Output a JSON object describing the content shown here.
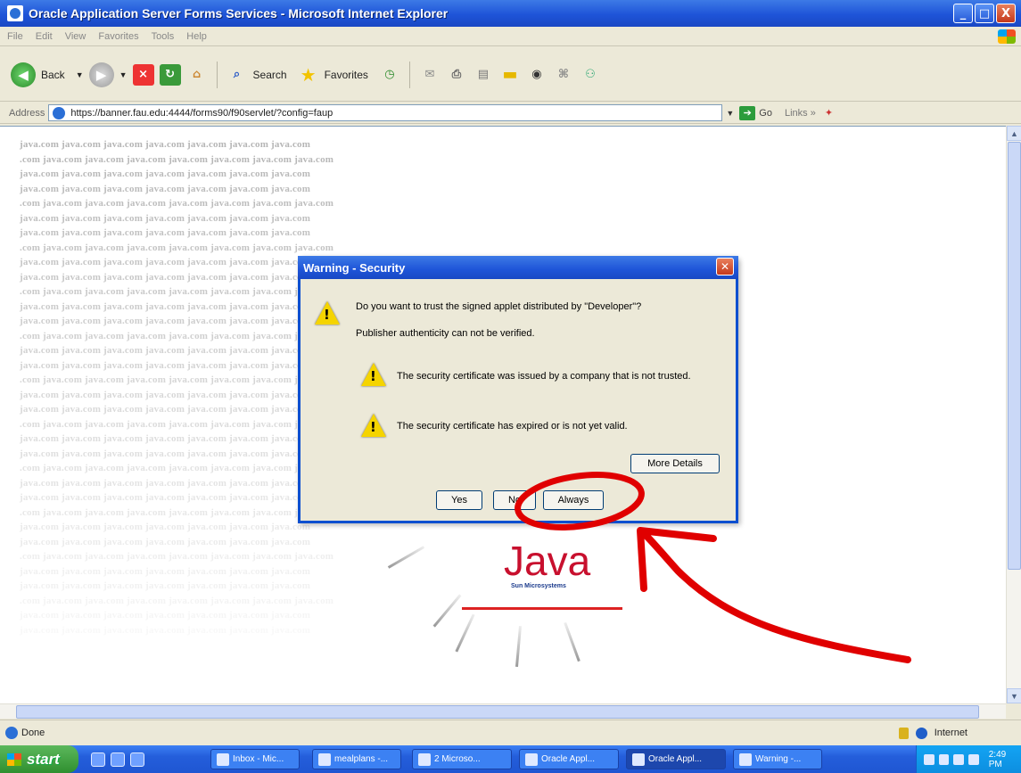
{
  "window": {
    "title": "Oracle Application Server Forms Services - Microsoft Internet Explorer",
    "buttons": {
      "minimize": "_",
      "maximize": "□",
      "close": "X"
    }
  },
  "menu": [
    "File",
    "Edit",
    "View",
    "Favorites",
    "Tools",
    "Help"
  ],
  "toolbar": {
    "back": "Back",
    "search": "Search",
    "favorites": "Favorites"
  },
  "address": {
    "label": "Address",
    "url": "https://banner.fau.edu:4444/forms90/f90servlet/?config=faup",
    "go": "Go",
    "links": "Links »"
  },
  "watermark": {
    "left": [
      "java.com  java.com  java.com  java.com  java.com  java.com  java.com",
      ".com  java.com  java.com  java.com  java.com  java.com  java.com  java.com",
      "java.com  java.com  java.com  java.com  java.com  java.com  java.com"
    ]
  },
  "dialog": {
    "title": "Warning - Security",
    "question": "Do you want to trust the signed applet distributed by \"Developer\"?",
    "publisher": "Publisher authenticity can not be verified.",
    "warning1": "The security certificate was issued by a company that is not trusted.",
    "warning2": "The security certificate has expired or is not yet valid.",
    "more_details": "More Details",
    "yes": "Yes",
    "no": "No",
    "always": "Always"
  },
  "java": {
    "word": "Java",
    "company": "Sun Microsystems"
  },
  "status": {
    "left": "Done",
    "zone": "Internet"
  },
  "taskbar": {
    "start": "start",
    "tasks": [
      "Inbox - Mic...",
      "mealplans -...",
      "2 Microso...",
      "Oracle Appl...",
      "Oracle Appl...",
      "Warning -..."
    ],
    "clock": "2:49 PM"
  },
  "annotation_color": "#e00000"
}
